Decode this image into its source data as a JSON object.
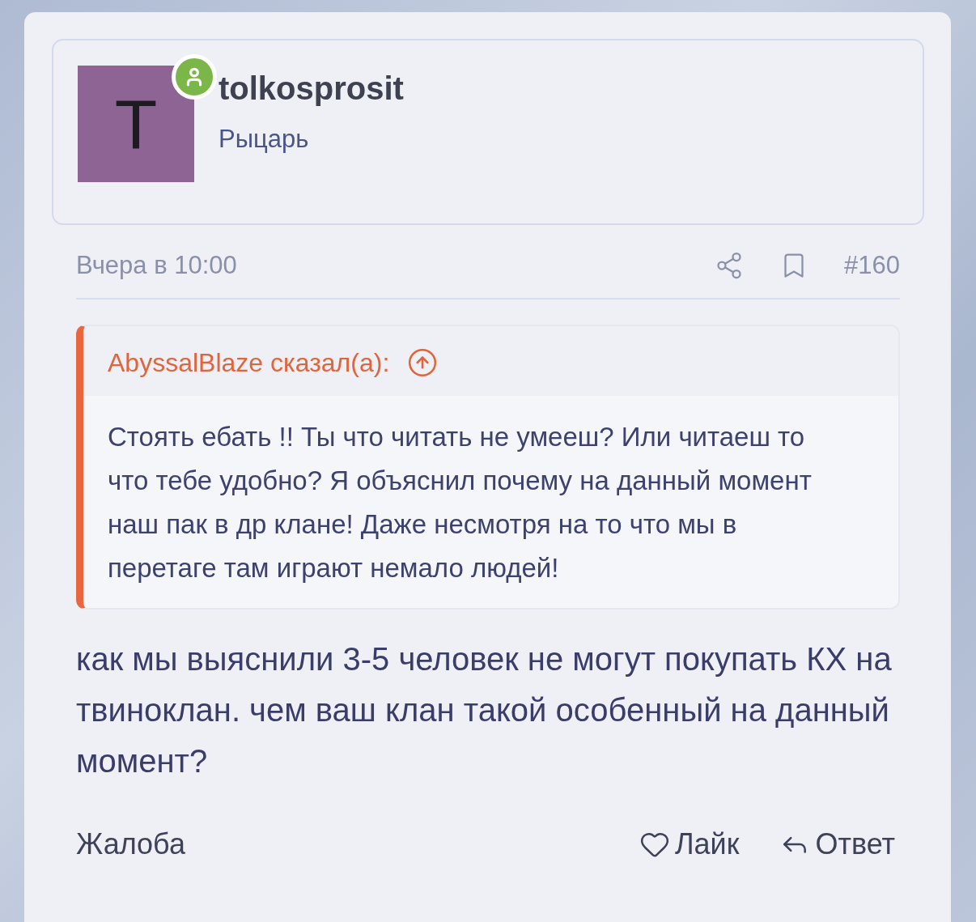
{
  "author": {
    "avatar_letter": "T",
    "online": true,
    "username": "tolkosprosit",
    "title": "Рыцарь"
  },
  "meta": {
    "time": "Вчера в 10:00",
    "post_number": "#160"
  },
  "quote": {
    "author_line": "AbyssalBlaze сказал(а):",
    "text": "Стоять ебать !! Ты что читать не умееш? Или читаеш то что тебе удобно? Я объяснил почему на данный момент наш пак в др клане! Даже несмотря на то что мы в перетаге там играют немало людей!"
  },
  "message": "как мы выяснили 3-5 человек не могут покупать КХ на твиноклан. чем ваш клан такой особенный на данный момент?",
  "actions": {
    "report": "Жалоба",
    "like": "Лайк",
    "reply": "Ответ"
  }
}
